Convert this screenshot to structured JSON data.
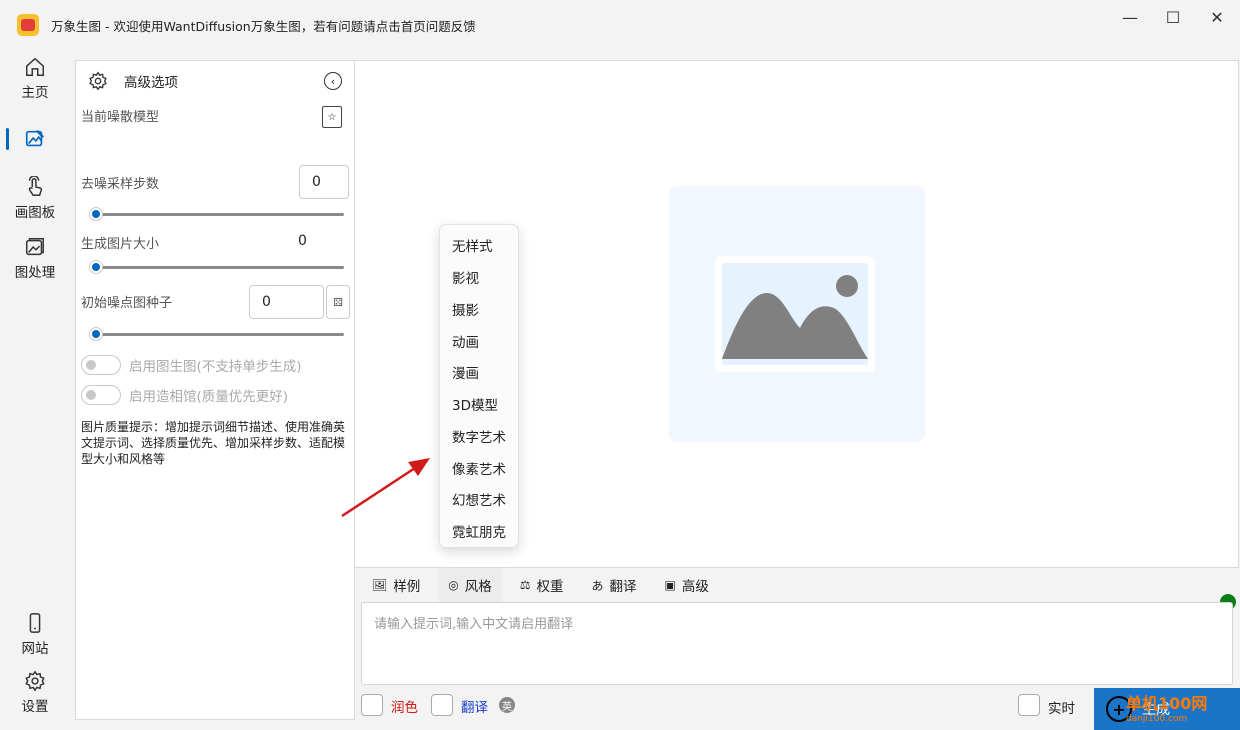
{
  "window": {
    "title": "万象生图 - 欢迎使用WantDiffusion万象生图，若有问题请点击首页问题反馈",
    "minimize": "—",
    "maximize": "☐",
    "close": "✕"
  },
  "nav": {
    "items": [
      {
        "label": "主页",
        "icon": "home-icon"
      },
      {
        "label": "",
        "icon": "image-generate-icon",
        "active": true
      },
      {
        "label": "画图板",
        "icon": "touch-draw-icon"
      },
      {
        "label": "图处理",
        "icon": "image-process-icon"
      },
      {
        "label": "网站",
        "icon": "phone-icon"
      },
      {
        "label": "设置",
        "icon": "gear-icon"
      }
    ]
  },
  "panel": {
    "title": "高级选项",
    "model_label": "当前噪散模型",
    "steps_label": "去噪采样步数",
    "steps_value": "0",
    "size_label": "生成图片大小",
    "size_value": "0",
    "seed_label": "初始噪点图种子",
    "seed_value": "0",
    "img2img_label": "启用图生图(不支持单步生成)",
    "studio_label": "启用造相馆(质量优先更好)",
    "hint": "图片质量提示：增加提示词细节描述、使用准确英文提示词、选择质量优先、增加采样步数、适配模型大小和风格等"
  },
  "style_menu": {
    "items": [
      "无样式",
      "影视",
      "摄影",
      "动画",
      "漫画",
      "3D模型",
      "数字艺术",
      "像素艺术",
      "幻想艺术",
      "霓虹朋克"
    ]
  },
  "tabs": [
    {
      "label": "样例",
      "icon": "sample-icon"
    },
    {
      "label": "风格",
      "icon": "palette-icon",
      "active": true
    },
    {
      "label": "权重",
      "icon": "scale-icon"
    },
    {
      "label": "翻译",
      "icon": "translate-icon"
    },
    {
      "label": "高级",
      "icon": "advanced-icon"
    }
  ],
  "prompt": {
    "placeholder": "请输入提示词,输入中文请启用翻译"
  },
  "options": {
    "polish_label": "润色",
    "translate_label": "翻译",
    "translate_badge": "英",
    "realtime_label": "实时"
  },
  "generate": {
    "label": "生成",
    "plus": "+"
  },
  "watermark": {
    "text": "单机100网",
    "sub": "danji100.com"
  },
  "colors": {
    "accent": "#0067c0",
    "status_ok": "#0b7d18",
    "polish": "#d11a1a",
    "translate": "#1a3fd1",
    "arrow": "#d11a1a"
  }
}
